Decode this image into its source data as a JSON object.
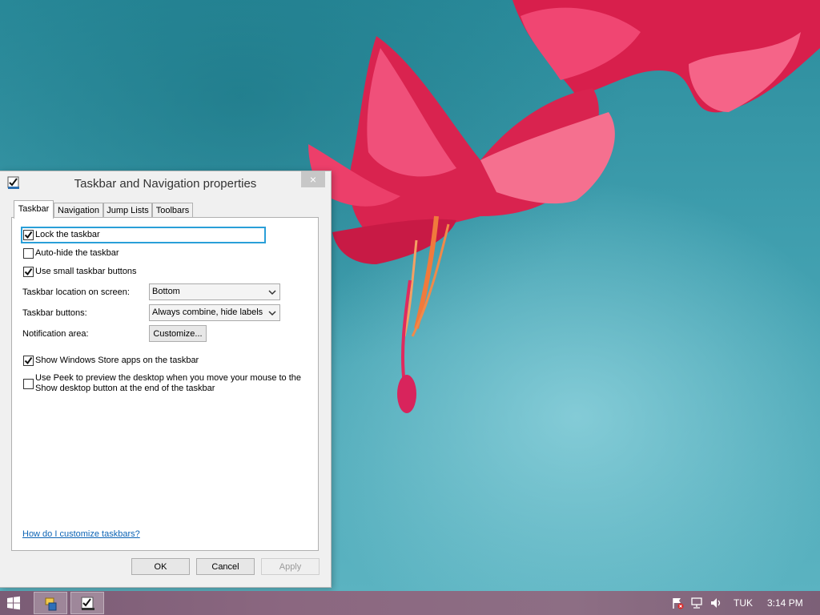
{
  "dialog": {
    "title": "Taskbar and Navigation properties",
    "close_glyph": "×",
    "tabs": [
      {
        "label": "Taskbar",
        "active": true
      },
      {
        "label": "Navigation",
        "active": false
      },
      {
        "label": "Jump Lists",
        "active": false
      },
      {
        "label": "Toolbars",
        "active": false
      }
    ],
    "options": {
      "lock_taskbar": {
        "label": "Lock the taskbar",
        "checked": true
      },
      "auto_hide": {
        "label": "Auto-hide the taskbar",
        "checked": false
      },
      "small_buttons": {
        "label": "Use small taskbar buttons",
        "checked": true
      },
      "store_apps": {
        "label": "Show Windows Store apps on the taskbar",
        "checked": true
      },
      "peek": {
        "label_line1": "Use Peek to preview the desktop when you move your mouse to the",
        "label_line2": "Show desktop button at the end of the taskbar",
        "checked": false
      }
    },
    "location": {
      "label": "Taskbar location on screen:",
      "value": "Bottom"
    },
    "buttons_setting": {
      "label": "Taskbar buttons:",
      "value": "Always combine, hide labels"
    },
    "notification": {
      "label": "Notification area:",
      "button": "Customize..."
    },
    "help_link": "How do I customize taskbars?",
    "footer": {
      "ok": "OK",
      "cancel": "Cancel",
      "apply": "Apply"
    }
  },
  "taskbar": {
    "language": "TUK",
    "time": "3:14 PM",
    "tray_icons": [
      "action-center-flag-icon",
      "network-icon",
      "volume-icon"
    ]
  },
  "colors": {
    "focus_ring": "#2a9fd8",
    "link": "#0b63b5",
    "taskbar": "#8b6780",
    "wallpaper": "#3f9eae",
    "flower": "#e2305c"
  }
}
